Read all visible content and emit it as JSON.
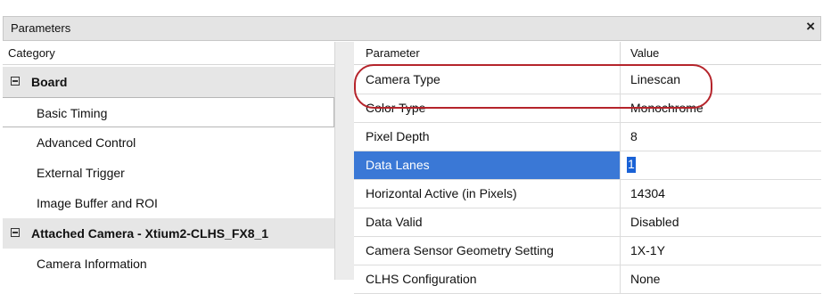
{
  "window": {
    "title": "Parameters",
    "close_glyph": "×"
  },
  "category_panel": {
    "header": "Category",
    "rows": [
      {
        "label": "Board",
        "kind": "group"
      },
      {
        "label": "Basic Timing",
        "kind": "selected"
      },
      {
        "label": "Advanced Control",
        "kind": "item"
      },
      {
        "label": "External Trigger",
        "kind": "item"
      },
      {
        "label": "Image Buffer and ROI",
        "kind": "item"
      },
      {
        "label": "Attached Camera - Xtium2-CLHS_FX8_1",
        "kind": "group"
      },
      {
        "label": "Camera Information",
        "kind": "item"
      }
    ]
  },
  "parameter_table": {
    "columns": [
      "Parameter",
      "Value"
    ],
    "rows": [
      {
        "parameter": "Camera Type",
        "value": "Linescan"
      },
      {
        "parameter": "Color Type",
        "value": "Monochrome"
      },
      {
        "parameter": "Pixel Depth",
        "value": "8"
      },
      {
        "parameter": "Data Lanes",
        "value": "1",
        "selected": true
      },
      {
        "parameter": "Horizontal Active (in Pixels)",
        "value": "14304"
      },
      {
        "parameter": "Data Valid",
        "value": "Disabled"
      },
      {
        "parameter": "Camera Sensor Geometry Setting",
        "value": "1X-1Y"
      },
      {
        "parameter": "CLHS Configuration",
        "value": "None"
      }
    ]
  },
  "colors": {
    "selection_blue": "#3a78d6",
    "annotation_red": "#b5242b",
    "group_gray": "#e6e6e6"
  }
}
